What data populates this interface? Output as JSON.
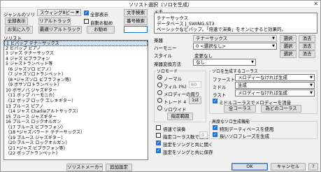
{
  "window": {
    "title": "ソリスト選択（ソロを生成）",
    "close": "✕"
  },
  "top": {
    "label": "ジャンルのソリ",
    "genre_select": "スウィング8ビート",
    "show_all": "全部表示",
    "text_search": "文字検索",
    "full_display": "全部表示",
    "real_track": "リアルトラック",
    "auto_recommend": "自動お勧め",
    "number_search": "番号検索",
    "favorites": "お気に入り",
    "recent_real_track": "最適リアルトラック",
    "recommend": "お勧め"
  },
  "soloist_list": {
    "label": "ソリスト",
    "items": [
      "1 ビバップ テナーサックス",
      "2 ビバップ ピアノ",
      "3 ジャズ テナーサックス",
      "4 ジャズ ビブラフォン",
      "5 ジャズトランペット等",
      "（6 ジャズソロ ピアノ）",
      "（7 ジャズソロトランペット）",
      "（8 *ジャズソロ ビブラフォン等）",
      "（9 ボサソロトランペット）",
      "10 ボサノバ ジャズギター",
      "（11 ボップ ハーモニカ）",
      "（12 ボップ ロック エレキギター）",
      "13 ブルース ピアノ",
      "（14 ジャズ Charlieアルトサックス）",
      "15 ブルース ジャズギター",
      "16 ブルース ロックオルガン",
      "（17 ブルース ビブラフォン）",
      "（18 *ジャズバラード テナーサックス）",
      "（19 ブルース ジャズギター）",
      "（20 ブルース ロックオルガン）",
      "（21 *ジャズ ビブラフォン等）",
      "（22 ボップトランペット）"
    ],
    "selected_index": 0
  },
  "memo": {
    "label": "メモ",
    "lines": [
      "テナーサックス",
      "データベース J_SWING.ST3",
      "ベーシックなビバップ。「倍速で演奏」をオンにすると効果的。"
    ]
  },
  "fields": {
    "instrument_label": "楽器",
    "instrument_value": "テナーサックス",
    "harmony_label": "ハーモニー",
    "harmony_value": "0 <選択なし>",
    "style_label": "スタイル",
    "style_value": "変更なし",
    "instrument_change_label": "楽器変換方法",
    "instrument_change_value": "なし",
    "select": "選択",
    "clear": "消去"
  },
  "solo_mode": {
    "label": "ソロモード",
    "normal": "ノーマル",
    "fill": "フィル (%)",
    "fill_value": "60",
    "melody_around": "メロディーの周り",
    "trade": "トレード 4",
    "trade_value": "1st",
    "solo_wide": "ソロワイド",
    "specify_section": "指定範囲"
  },
  "chorus_gen": {
    "label": "ソロを生成するコーラス",
    "first": "ファースト",
    "first_value": "メロディーなければ生成",
    "middle": "ミドル",
    "middle_value": "生成",
    "last": "ラスト",
    "last_value": "メロディーなければ生成",
    "middle_chorus_mute": "ミドルコーラスでメロディーを消音",
    "all_chorus": "全コーラス",
    "my_chorus": "為どのコーラス"
  },
  "options": {
    "double_time": "倍速で演奏",
    "fixed_count": "指定コーラス数で生成",
    "fixed_count_value": "1",
    "save_with_song": "設定をソングと共に開く",
    "save_with_song2": "設定をソングと共に保存"
  },
  "advanced": {
    "label": "高度なソロ生成機能",
    "special_dev": "特別デーティベースを使用",
    "long_phrase": "長いソロフレーズを生成"
  },
  "bottom": {
    "soloist_maker": "ソリストメーカー",
    "add_setting": "追加設定",
    "ok": "OK",
    "cancel": "キャンセル",
    "help": "?"
  }
}
